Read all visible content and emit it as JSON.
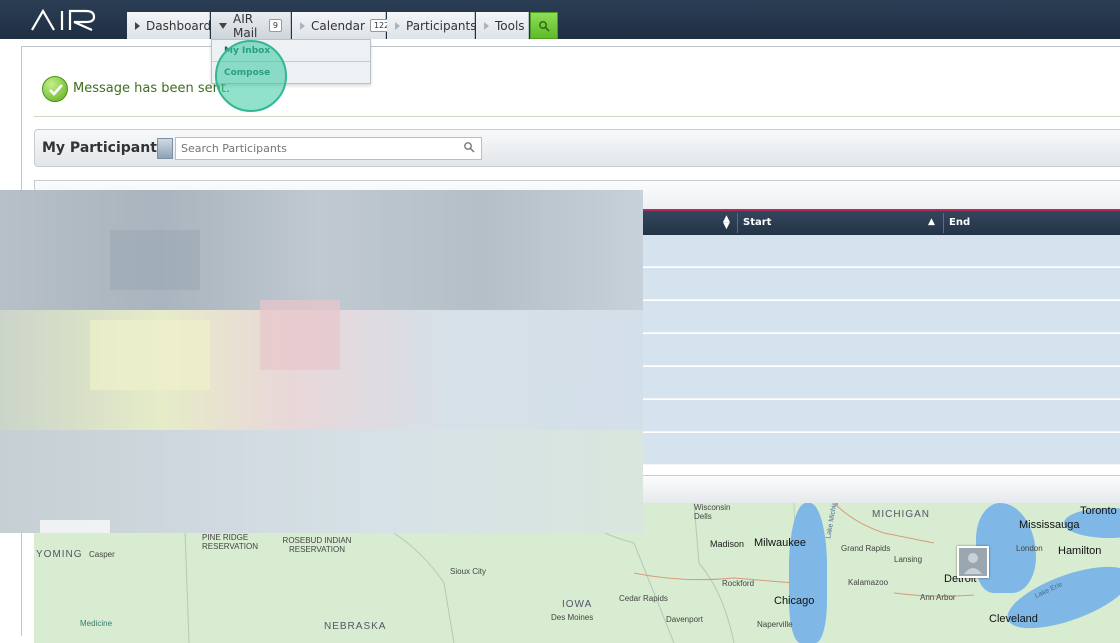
{
  "app": {
    "logo": "AIR"
  },
  "nav": {
    "tabs": [
      {
        "label": "Dashboard"
      },
      {
        "label": "AIR Mail",
        "badge": "9"
      },
      {
        "label": "Calendar",
        "badge": "122"
      },
      {
        "label": "Participants"
      },
      {
        "label": "Tools"
      }
    ],
    "search_icon": "search-icon"
  },
  "dropdown": {
    "items": [
      {
        "label": "My Inbox"
      },
      {
        "label": "Compose"
      }
    ]
  },
  "alert": {
    "message": "Message has been sent."
  },
  "participants": {
    "title": "My Participants",
    "search_placeholder": "Search Participants"
  },
  "table": {
    "columns": [
      {
        "label": "Start"
      },
      {
        "label": "End"
      }
    ]
  },
  "map": {
    "labels": [
      "MICHIGAN",
      "Mississauga",
      "Toronto",
      "Hamilton",
      "London",
      "Wisconsin Dells",
      "Madison",
      "Milwaukee",
      "Grand Rapids",
      "Lansing",
      "Detroit",
      "Rockford",
      "Kalamazoo",
      "Chicago",
      "Ann Arbor",
      "Cleveland",
      "Cedar Rapids",
      "IOWA",
      "Des Moines",
      "Davenport",
      "Naperville",
      "Sioux City",
      "PINE RIDGE RESERVATION",
      "ROSEBUD INDIAN RESERVATION",
      "YOMING",
      "Casper",
      "Medicine",
      "NEBRASKA",
      "Lake Michigan",
      "Lake Erie"
    ]
  },
  "colors": {
    "topbar": "#233447",
    "accent_green": "#5ebb2a",
    "table_header": "#2b3d52",
    "row": "#d5e3ee",
    "success_text": "#3f6e1f"
  }
}
